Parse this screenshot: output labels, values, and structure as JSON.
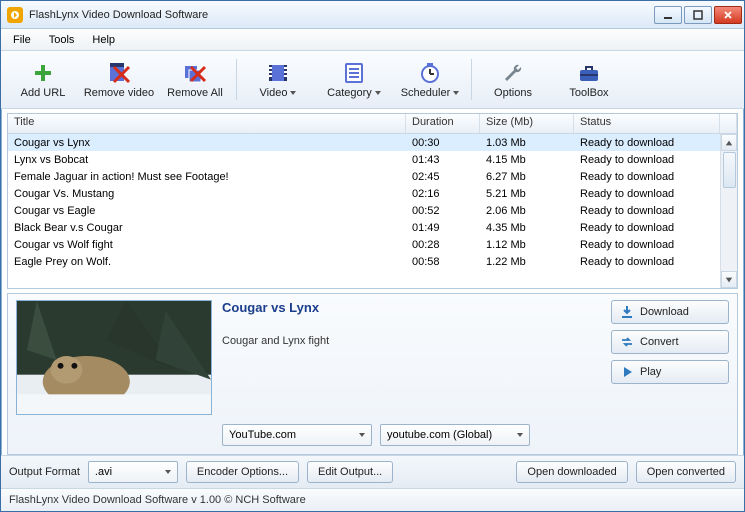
{
  "window": {
    "title": "FlashLynx Video Download Software"
  },
  "menu": {
    "file": "File",
    "tools": "Tools",
    "help": "Help"
  },
  "toolbar": {
    "add_url": "Add URL",
    "remove_video": "Remove video",
    "remove_all": "Remove All",
    "video": "Video",
    "category": "Category",
    "scheduler": "Scheduler",
    "options": "Options",
    "toolbox": "ToolBox"
  },
  "columns": {
    "title": "Title",
    "duration": "Duration",
    "size": "Size (Mb)",
    "status": "Status"
  },
  "rows": [
    {
      "title": "Cougar vs Lynx",
      "duration": "00:30",
      "size": "1.03 Mb",
      "status": "Ready to download"
    },
    {
      "title": "Lynx vs Bobcat",
      "duration": "01:43",
      "size": "4.15 Mb",
      "status": "Ready to download"
    },
    {
      "title": "Female Jaguar in action! Must see Footage!",
      "duration": "02:45",
      "size": "6.27 Mb",
      "status": "Ready to download"
    },
    {
      "title": "Cougar Vs. Mustang",
      "duration": "02:16",
      "size": "5.21 Mb",
      "status": "Ready to download"
    },
    {
      "title": "Cougar vs Eagle",
      "duration": "00:52",
      "size": "2.06 Mb",
      "status": "Ready to download"
    },
    {
      "title": "Black Bear v.s Cougar",
      "duration": "01:49",
      "size": "4.35 Mb",
      "status": "Ready to download"
    },
    {
      "title": "Cougar vs Wolf fight",
      "duration": "00:28",
      "size": "1.12 Mb",
      "status": "Ready to download"
    },
    {
      "title": "Eagle Prey on Wolf.",
      "duration": "00:58",
      "size": "1.22 Mb",
      "status": "Ready to download"
    }
  ],
  "detail": {
    "title": "Cougar vs Lynx",
    "description": "Cougar and Lynx fight",
    "source_select": "YouTube.com",
    "region_select": "youtube.com (Global)"
  },
  "side": {
    "download": "Download",
    "convert": "Convert",
    "play": "Play"
  },
  "bottom": {
    "output_format_label": "Output Format",
    "output_format_value": ".avi",
    "encoder_options": "Encoder Options...",
    "edit_output": "Edit Output...",
    "open_downloaded": "Open downloaded",
    "open_converted": "Open converted"
  },
  "statusbar": "FlashLynx Video Download Software v 1.00 © NCH Software"
}
